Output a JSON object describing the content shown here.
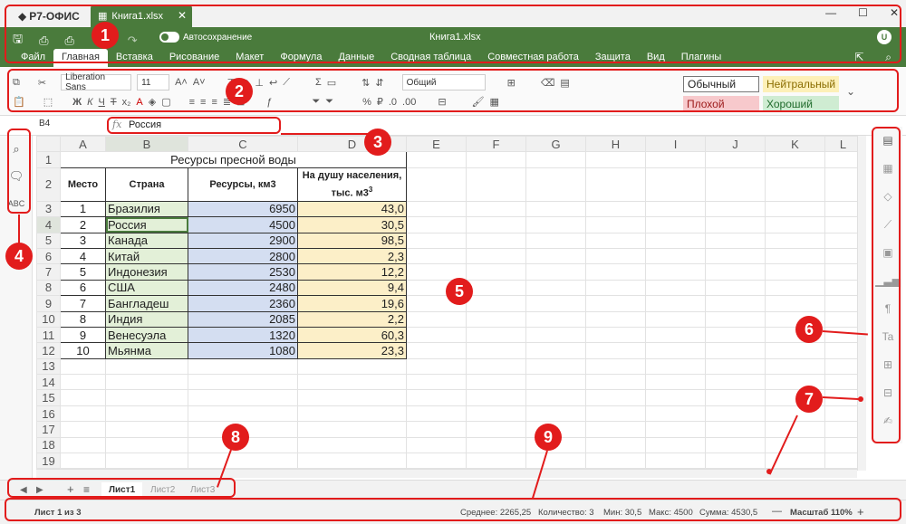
{
  "app": {
    "name": "Р7-ОФИС",
    "doc_tab": "Книга1.xlsx",
    "doc_title": "Книга1.xlsx",
    "autosave": "Автосохранение",
    "user_initial": "U"
  },
  "menu": [
    "Файл",
    "Главная",
    "Вставка",
    "Рисование",
    "Макет",
    "Формула",
    "Данные",
    "Сводная таблица",
    "Совместная работа",
    "Защита",
    "Вид",
    "Плагины"
  ],
  "ribbon": {
    "font_name": "Liberation Sans",
    "font_size": "11",
    "number_format": "Общий",
    "styles": {
      "normal": "Обычный",
      "neutral": "Нейтральный",
      "bad": "Плохой",
      "good": "Хороший"
    },
    "style_colors": {
      "normal": "#ffffff",
      "neutral": "#fdf0b8",
      "bad": "#f7c9cc",
      "good": "#cfecd2"
    }
  },
  "formula_bar": {
    "cell": "B4",
    "fx": "fx",
    "value": "Россия"
  },
  "columns": [
    "A",
    "B",
    "C",
    "D",
    "E",
    "F",
    "G",
    "H",
    "I",
    "J",
    "K",
    "L"
  ],
  "rows": [
    "1",
    "2",
    "3",
    "4",
    "5",
    "6",
    "7",
    "8",
    "9",
    "10",
    "11",
    "12",
    "13",
    "14",
    "15",
    "16",
    "17",
    "18",
    "19"
  ],
  "table": {
    "title": "Ресурсы пресной воды",
    "headers": [
      "Место",
      "Страна",
      "Ресурсы, км3",
      "На душу населения, тыс. м3"
    ],
    "h4_sup": "3",
    "data": [
      [
        "1",
        "Бразилия",
        "6950",
        "43,0"
      ],
      [
        "2",
        "Россия",
        "4500",
        "30,5"
      ],
      [
        "3",
        "Канада",
        "2900",
        "98,5"
      ],
      [
        "4",
        "Китай",
        "2800",
        "2,3"
      ],
      [
        "5",
        "Индонезия",
        "2530",
        "12,2"
      ],
      [
        "6",
        "США",
        "2480",
        "9,4"
      ],
      [
        "7",
        "Бангладеш",
        "2360",
        "19,6"
      ],
      [
        "8",
        "Индия",
        "2085",
        "2,2"
      ],
      [
        "9",
        "Венесуэла",
        "1320",
        "60,3"
      ],
      [
        "10",
        "Мьянма",
        "1080",
        "23,3"
      ]
    ]
  },
  "sheets": [
    "Лист1",
    "Лист2",
    "Лист3"
  ],
  "status": {
    "sheet_of": "Лист 1 из 3",
    "avg": "Среднее: 2265,25",
    "count": "Количество: 3",
    "min": "Мин: 30,5",
    "max": "Макс: 4500",
    "sum": "Сумма: 4530,5",
    "zoom": "Масштаб 110%"
  },
  "markers": [
    "1",
    "2",
    "3",
    "4",
    "5",
    "6",
    "7",
    "8",
    "9"
  ],
  "colors": {
    "accent": "#4a7b3c",
    "marker": "#e21c1c"
  }
}
